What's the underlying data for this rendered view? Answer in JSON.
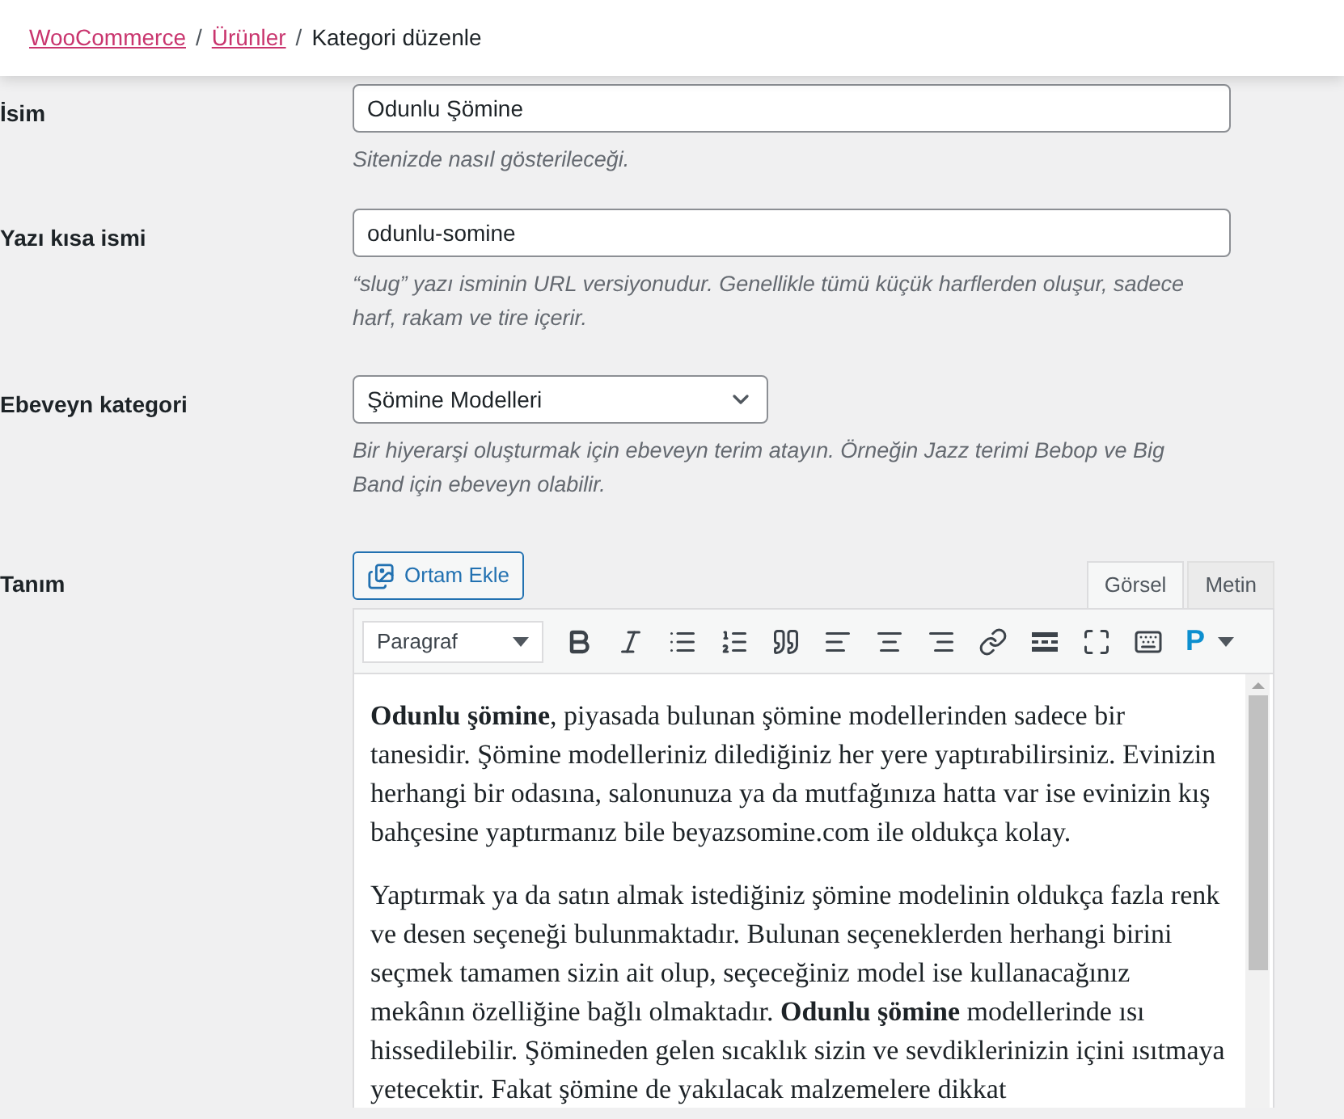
{
  "breadcrumb": [
    {
      "label": "WooCommerce",
      "kind": "link"
    },
    {
      "label": "/",
      "kind": "separator"
    },
    {
      "label": "Ürünler",
      "kind": "link"
    },
    {
      "label": "/",
      "kind": "separator"
    },
    {
      "label": "Kategori düzenle",
      "kind": "current"
    }
  ],
  "fields": [
    {
      "label": "İsim",
      "kind": "text",
      "value": "Odunlu Şömine",
      "help": "Sitenizde nasıl gösterileceği."
    },
    {
      "label": "Yazı kısa ismi",
      "kind": "text",
      "value": "odunlu-somine",
      "help": "“slug” yazı isminin URL versiyonudur. Genellikle tümü küçük harflerden oluşur, sadece harf, rakam ve tire içerir."
    },
    {
      "label": "Ebeveyn kategori",
      "kind": "select",
      "value": "Şömine Modelleri",
      "help": "Bir hiyerarşi oluşturmak için ebeveyn terim atayın. Örneğin Jazz terimi Bebop ve Big Band için ebeveyn olabilir."
    }
  ],
  "editor": {
    "label": "Tanım",
    "media_button": "Ortam Ekle",
    "tabs": [
      {
        "label": "Görsel",
        "selected": true
      },
      {
        "label": "Metin",
        "selected": false
      }
    ],
    "format_select": "Paragraf",
    "plugin_button": "P",
    "paragraphs": [
      "**Odunlu şömine**, piyasada bulunan şömine modellerinden sadece bir tanesidir. Şömine modelleriniz dilediğiniz her yere yaptırabilirsiniz. Evinizin herhangi bir odasına, salonunuza ya da mutfağınıza hatta var ise evinizin kış bahçesine yaptırmanız bile beyazsomine.com ile oldukça kolay.",
      "Yaptırmak ya da satın almak istediğiniz şömine modelinin oldukça fazla renk ve desen seçeneği bulunmaktadır. Bulunan seçeneklerden herhangi birini seçmek tamamen sizin ait olup, seçeceğiniz model ise kullanacağınız mekânın özelliğine bağlı olmaktadır. **Odunlu şömine** modellerinde ısı hissedilebilir. Şömineden gelen sıcaklık sizin ve sevdiklerinizin içini ısıtmaya yetecektir. Fakat şömine de yakılacak malzemelere dikkat"
    ]
  }
}
